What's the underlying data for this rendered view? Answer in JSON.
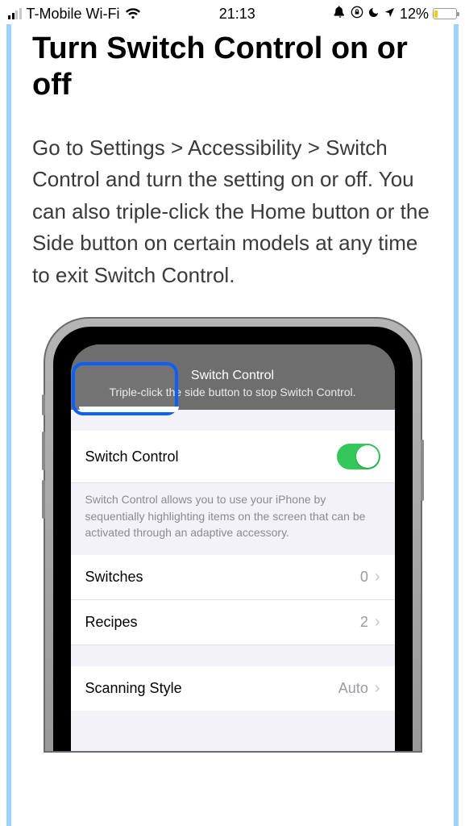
{
  "status": {
    "carrier": "T-Mobile Wi-Fi",
    "time": "21:13",
    "battery_pct": "12%"
  },
  "article": {
    "title": "Turn Switch Control on or off",
    "body": "Go to Settings > Accessibility > Switch Control and turn the setting on or off. You can also triple-click the Home button or the Side button on certain models at any time to exit Switch Control."
  },
  "mock": {
    "overlay_title": "Switch Control",
    "overlay_subtitle": "Triple-click the side button to stop Switch Control.",
    "toggle_row": {
      "label": "Switch Control",
      "on": true
    },
    "toggle_footer": "Switch Control allows you to use your iPhone by sequentially highlighting items on the screen that can be activated through an adaptive accessory.",
    "rows": [
      {
        "label": "Switches",
        "value": "0"
      },
      {
        "label": "Recipes",
        "value": "2"
      }
    ],
    "scanning": {
      "label": "Scanning Style",
      "value": "Auto"
    }
  }
}
